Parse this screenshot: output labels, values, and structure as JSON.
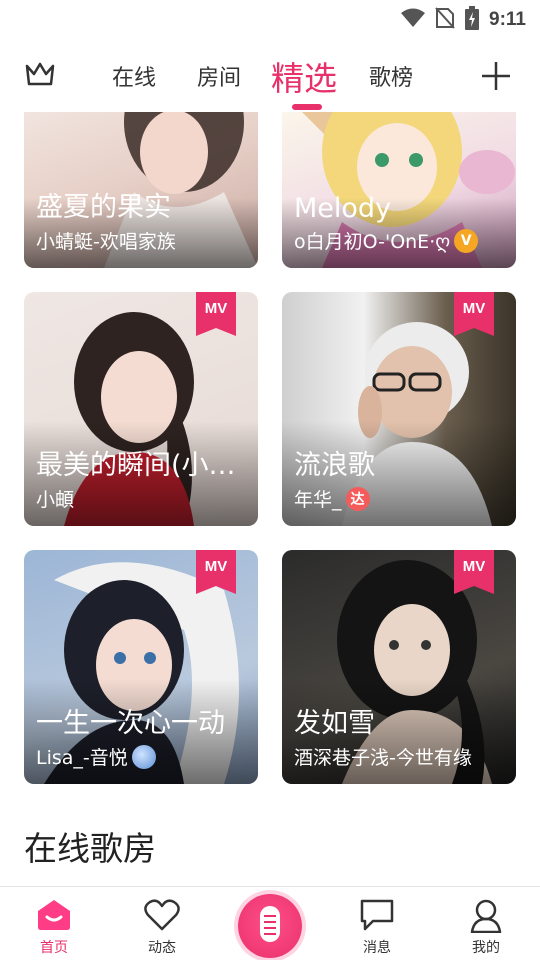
{
  "status_bar": {
    "time": "9:11"
  },
  "top_nav": {
    "tabs": [
      "在线",
      "房间",
      "精选",
      "歌榜"
    ],
    "active_tab": "精选"
  },
  "cards": [
    {
      "title": "盛夏的果实",
      "author": "小蜻蜓-欢唱家族",
      "mv": false,
      "badge": ""
    },
    {
      "title": "Melody",
      "author": "o白月初O-'OnE·ღ",
      "mv": false,
      "badge": "V"
    },
    {
      "title": "最美的瞬间(小阿...",
      "author": "小頔",
      "mv": true,
      "badge": ""
    },
    {
      "title": "流浪歌",
      "author": "年华_",
      "mv": true,
      "badge": "达"
    },
    {
      "title": "一生一次心一动",
      "author": "Lisa_-音悦",
      "mv": true,
      "badge": "gem"
    },
    {
      "title": "发如雪",
      "author": "酒深巷子浅-今世有缘",
      "mv": true,
      "badge": ""
    }
  ],
  "mv_label": "MV",
  "section_title": "在线歌房",
  "bottom_bar": {
    "items": [
      {
        "label": "首页",
        "icon": "home-icon",
        "active": true
      },
      {
        "label": "动态",
        "icon": "heart-icon",
        "active": false
      },
      {
        "label": "消息",
        "icon": "message-icon",
        "active": false
      },
      {
        "label": "我的",
        "icon": "profile-icon",
        "active": false
      }
    ]
  },
  "colors": {
    "accent": "#e8306b",
    "text": "#333333"
  }
}
